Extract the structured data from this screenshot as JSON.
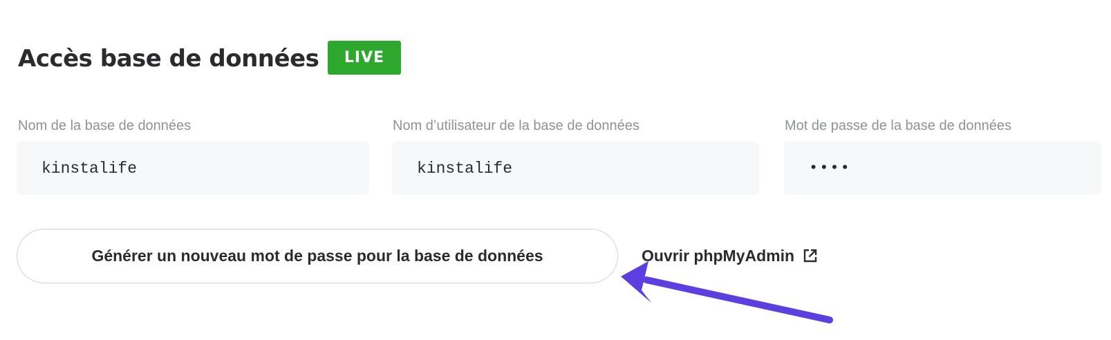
{
  "header": {
    "title": "Accès base de données",
    "badge": "LIVE"
  },
  "fields": [
    {
      "label": "Nom de la base de données",
      "value": "kinstalife"
    },
    {
      "label": "Nom d’utilisateur de la base de données",
      "value": "kinstalife"
    },
    {
      "label": "Mot de passe de la base de données",
      "value": "••••"
    }
  ],
  "actions": {
    "generate_password_label": "Générer un nouveau mot de passe pour la base de données",
    "open_phpmyadmin_label": "Ouvrir phpMyAdmin",
    "open_phpmyadmin_icon": "external-link-icon"
  },
  "colors": {
    "live_badge": "#2ea82c",
    "annotation_arrow": "#5b3fe0"
  }
}
